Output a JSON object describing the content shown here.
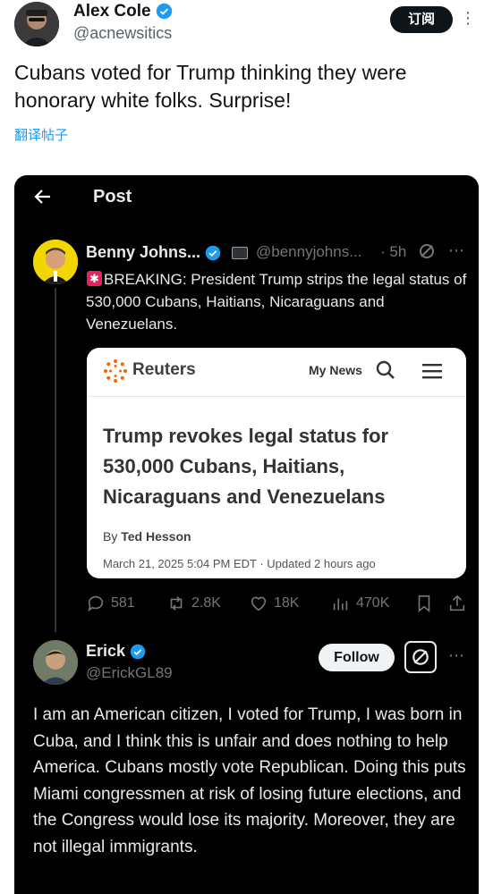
{
  "outer_tweet": {
    "author_name": "Alex Cole",
    "author_handle": "@acnewsitics",
    "subscribe_label": "订阅",
    "more_icon": "more-dots-icon",
    "text": "Cubans voted for Trump thinking they were honorary white folks. Surprise!",
    "translate_label": "翻译帖子"
  },
  "embedded_screenshot": {
    "header_title": "Post",
    "back_icon": "back-arrow-icon",
    "quoted_post": {
      "author_name": "Benny Johns...",
      "author_handle": "@bennyjohns...",
      "time": "· 5h",
      "text": "BREAKING: President Trump strips the legal status of 530,000 Cubans, Haitians, Nicaraguans and Venezuelans.",
      "link_card": {
        "site_name": "Reuters",
        "nav_label": "My News",
        "headline": "Trump revokes legal status for 530,000 Cubans, Haitians, Nicaraguans and Venezuelans",
        "byline_prefix": "By",
        "byline_author": "Ted Hesson",
        "dateline": "March 21, 2025 5:04 PM EDT · Updated 2 hours ago"
      },
      "stats": {
        "replies": "581",
        "reposts": "2.8K",
        "likes": "18K",
        "views": "470K"
      }
    },
    "reply_post": {
      "author_name": "Erick",
      "author_handle": "@ErickGL89",
      "follow_label": "Follow",
      "text": "I am an American citizen, I voted for Trump, I was born in Cuba, and I think this is unfair and does nothing to help America. Cubans mostly vote Republican. Doing this puts Miami congressmen at risk of losing future elections, and the Congress would lose its majority. Moreover, they are not illegal immigrants."
    }
  },
  "colors": {
    "verified_blue": "#1d9bf0",
    "dark_bg": "#000000",
    "muted_text": "#71767b",
    "link_blue": "#1d9bf0"
  }
}
